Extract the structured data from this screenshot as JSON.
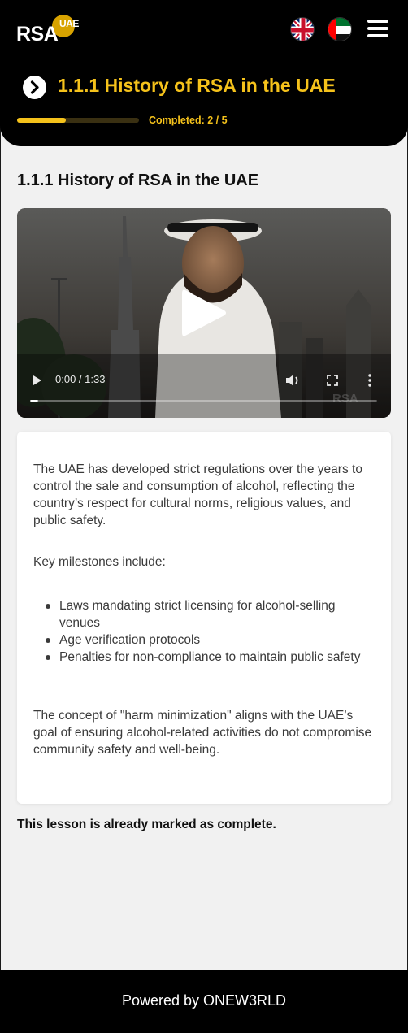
{
  "header": {
    "logo_text": "RSA",
    "logo_sup": "UAE",
    "title": "1.1.1 History of RSA in the UAE",
    "progress": {
      "completed_label": "Completed: 2 / 5",
      "completed": 2,
      "total": 5
    },
    "languages": [
      {
        "name": "English",
        "icon": "uk-flag-icon"
      },
      {
        "name": "Arabic",
        "icon": "uae-flag-icon"
      }
    ],
    "menu_icon": "hamburger-menu-icon"
  },
  "lesson": {
    "title": "1.1.1 History of RSA in the UAE",
    "video": {
      "current_time": "0:00",
      "duration": "1:33",
      "time_label": "0:00 / 1:33",
      "watermark": "RSA"
    },
    "content": {
      "paragraph1": "The UAE has developed strict regulations over the years to control the sale and consumption of alcohol, reflecting the country’s respect for cultural norms, religious values, and public safety.",
      "paragraph2": "Key milestones include:",
      "milestones": [
        "Laws mandating strict licensing for alcohol-selling venues",
        "Age verification protocols",
        "Penalties for non-compliance to maintain public safety"
      ],
      "paragraph3": "The concept of \"harm minimization\" aligns with the UAE’s goal of ensuring alcohol-related activities do not compromise community safety and well-being."
    },
    "status_note": "This lesson is already marked as complete."
  },
  "footer": {
    "text": "Powered by ONEW3RLD"
  },
  "colors": {
    "accent": "#f5c21b",
    "header_bg": "#000000",
    "page_bg": "#f1f1f1"
  }
}
